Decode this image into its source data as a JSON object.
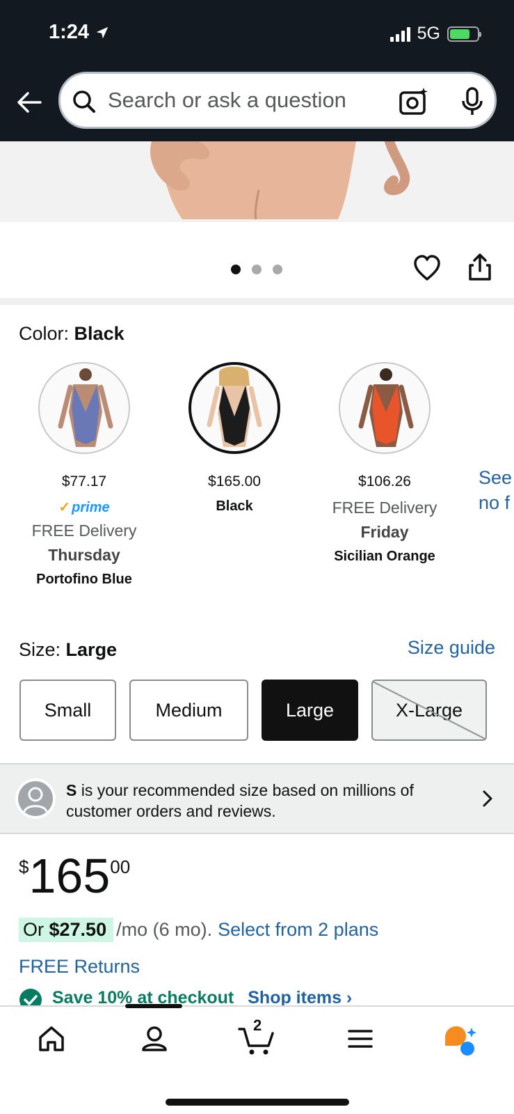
{
  "status_bar": {
    "time": "1:24",
    "network": "5G"
  },
  "search": {
    "placeholder": "Search or ask a question"
  },
  "gallery": {
    "page_count": 3,
    "active_index": 0
  },
  "color": {
    "label": "Color:",
    "selected": "Black",
    "options": [
      {
        "price": "$77.17",
        "prime": "prime",
        "delivery": "FREE Delivery",
        "day": "Thursday",
        "name": "Portofino Blue",
        "color": "#6a78b8"
      },
      {
        "price": "$165.00",
        "name": "Black",
        "color": "#1c1c1c",
        "selected": true
      },
      {
        "price": "$106.26",
        "delivery": "FREE Delivery",
        "day": "Friday",
        "name": "Sicilian Orange",
        "color": "#e8552a"
      }
    ],
    "see_more": "See",
    "see_more_2": "no f"
  },
  "size": {
    "label": "Size:",
    "selected": "Large",
    "guide": "Size guide",
    "options": [
      "Small",
      "Medium",
      "Large",
      "X-Large"
    ]
  },
  "recommendation": {
    "size": "S",
    "text": " is your recommended size based on millions of customer orders and reviews."
  },
  "price": {
    "symbol": "$",
    "whole": "165",
    "fraction": "00",
    "monthly_prefix": "Or ",
    "monthly_amount": "$27.50",
    "monthly_suffix": "/mo (6 mo).",
    "plans_link": "Select from 2 plans",
    "returns": "FREE Returns",
    "save": "Save 10% at checkout",
    "shop": "Shop items ›"
  },
  "nav": {
    "cart_count": "2"
  },
  "colors": {
    "header": "#131921",
    "link": "#2162a1",
    "accent_green": "#067d62",
    "prime_blue": "#1a98ff"
  }
}
